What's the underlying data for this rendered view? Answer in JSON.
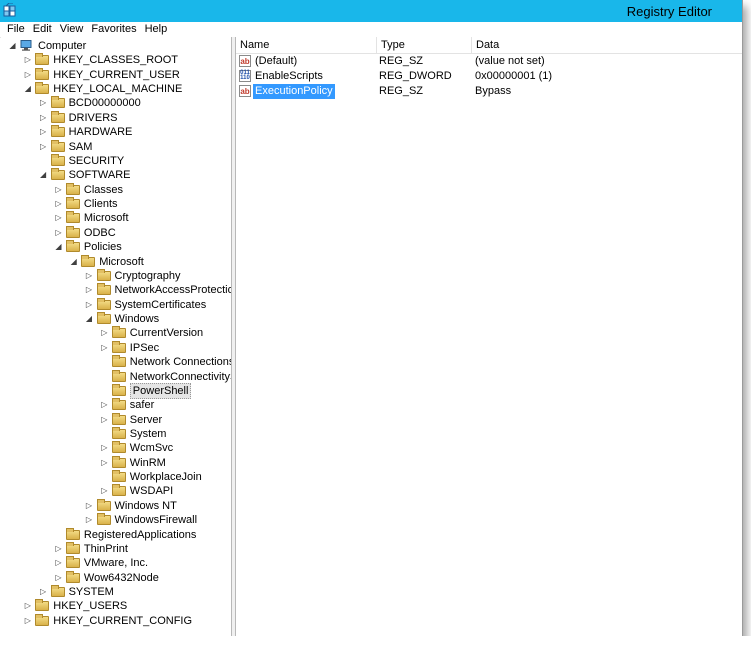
{
  "window": {
    "title": "Registry Editor"
  },
  "menu": [
    "File",
    "Edit",
    "View",
    "Favorites",
    "Help"
  ],
  "tree": [
    {
      "label": "Computer",
      "level": 0,
      "exp": "open",
      "icon": "computer"
    },
    {
      "label": "HKEY_CLASSES_ROOT",
      "level": 1,
      "exp": "closed"
    },
    {
      "label": "HKEY_CURRENT_USER",
      "level": 1,
      "exp": "closed"
    },
    {
      "label": "HKEY_LOCAL_MACHINE",
      "level": 1,
      "exp": "open"
    },
    {
      "label": "BCD00000000",
      "level": 2,
      "exp": "closed"
    },
    {
      "label": "DRIVERS",
      "level": 2,
      "exp": "closed"
    },
    {
      "label": "HARDWARE",
      "level": 2,
      "exp": "closed"
    },
    {
      "label": "SAM",
      "level": 2,
      "exp": "closed"
    },
    {
      "label": "SECURITY",
      "level": 2,
      "exp": "none"
    },
    {
      "label": "SOFTWARE",
      "level": 2,
      "exp": "open"
    },
    {
      "label": "Classes",
      "level": 3,
      "exp": "closed"
    },
    {
      "label": "Clients",
      "level": 3,
      "exp": "closed"
    },
    {
      "label": "Microsoft",
      "level": 3,
      "exp": "closed"
    },
    {
      "label": "ODBC",
      "level": 3,
      "exp": "closed"
    },
    {
      "label": "Policies",
      "level": 3,
      "exp": "open"
    },
    {
      "label": "Microsoft",
      "level": 4,
      "exp": "open"
    },
    {
      "label": "Cryptography",
      "level": 5,
      "exp": "closed"
    },
    {
      "label": "NetworkAccessProtection",
      "level": 5,
      "exp": "closed"
    },
    {
      "label": "SystemCertificates",
      "level": 5,
      "exp": "closed"
    },
    {
      "label": "Windows",
      "level": 5,
      "exp": "open"
    },
    {
      "label": "CurrentVersion",
      "level": 6,
      "exp": "closed"
    },
    {
      "label": "IPSec",
      "level": 6,
      "exp": "closed"
    },
    {
      "label": "Network Connections",
      "level": 6,
      "exp": "none"
    },
    {
      "label": "NetworkConnectivitySta",
      "level": 6,
      "exp": "none"
    },
    {
      "label": "PowerShell",
      "level": 6,
      "exp": "none",
      "selected": true
    },
    {
      "label": "safer",
      "level": 6,
      "exp": "closed"
    },
    {
      "label": "Server",
      "level": 6,
      "exp": "closed"
    },
    {
      "label": "System",
      "level": 6,
      "exp": "none"
    },
    {
      "label": "WcmSvc",
      "level": 6,
      "exp": "closed"
    },
    {
      "label": "WinRM",
      "level": 6,
      "exp": "closed"
    },
    {
      "label": "WorkplaceJoin",
      "level": 6,
      "exp": "none"
    },
    {
      "label": "WSDAPI",
      "level": 6,
      "exp": "closed"
    },
    {
      "label": "Windows NT",
      "level": 5,
      "exp": "closed"
    },
    {
      "label": "WindowsFirewall",
      "level": 5,
      "exp": "closed"
    },
    {
      "label": "RegisteredApplications",
      "level": 3,
      "exp": "none"
    },
    {
      "label": "ThinPrint",
      "level": 3,
      "exp": "closed"
    },
    {
      "label": "VMware, Inc.",
      "level": 3,
      "exp": "closed"
    },
    {
      "label": "Wow6432Node",
      "level": 3,
      "exp": "closed"
    },
    {
      "label": "SYSTEM",
      "level": 2,
      "exp": "closed"
    },
    {
      "label": "HKEY_USERS",
      "level": 1,
      "exp": "closed"
    },
    {
      "label": "HKEY_CURRENT_CONFIG",
      "level": 1,
      "exp": "closed"
    }
  ],
  "columns": {
    "name": "Name",
    "type": "Type",
    "data": "Data"
  },
  "values": [
    {
      "name": "(Default)",
      "type": "REG_SZ",
      "data": "(value not set)",
      "icon": "string-value-icon",
      "icon_text": "ab",
      "kind": "sz"
    },
    {
      "name": "EnableScripts",
      "type": "REG_DWORD",
      "data": "0x00000001 (1)",
      "icon": "dword-value-icon",
      "icon_text": "011 110",
      "kind": "dw"
    },
    {
      "name": "ExecutionPolicy",
      "type": "REG_SZ",
      "data": "Bypass",
      "icon": "string-value-icon",
      "icon_text": "ab",
      "kind": "sz",
      "selected": true
    }
  ]
}
